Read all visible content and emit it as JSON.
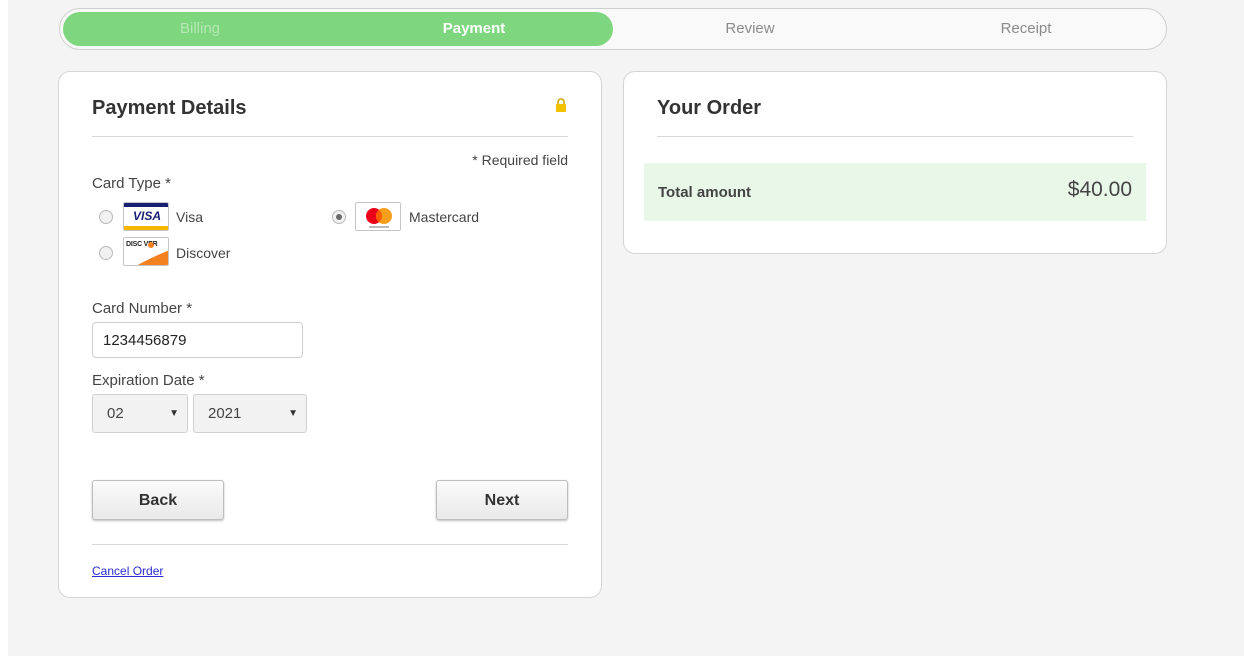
{
  "steps": [
    {
      "label": "Billing",
      "state": "done"
    },
    {
      "label": "Payment",
      "state": "active"
    },
    {
      "label": "Review",
      "state": "pending"
    },
    {
      "label": "Receipt",
      "state": "pending"
    }
  ],
  "colors": {
    "progress_fill": "#7ed67e",
    "total_band": "#e8f7e8",
    "link": "#2a2ad8"
  },
  "payment": {
    "title": "Payment Details",
    "lock_icon": "lock-icon",
    "required_note": "* Required field",
    "card_type_label": "Card Type *",
    "card_types": [
      {
        "name": "Visa",
        "logo_text": "VISA",
        "checked": false
      },
      {
        "name": "Mastercard",
        "checked": true
      },
      {
        "name": "Discover",
        "logo_text": "DISC  VER",
        "checked": false
      }
    ],
    "card_number_label": "Card Number *",
    "card_number_value": "1234456879",
    "expiration_label": "Expiration Date *",
    "exp_month": "02",
    "exp_year": "2021",
    "back_label": "Back",
    "next_label": "Next",
    "cancel_label": "Cancel Order"
  },
  "order": {
    "title": "Your Order",
    "total_label": "Total amount",
    "total_value": "$40.00"
  }
}
